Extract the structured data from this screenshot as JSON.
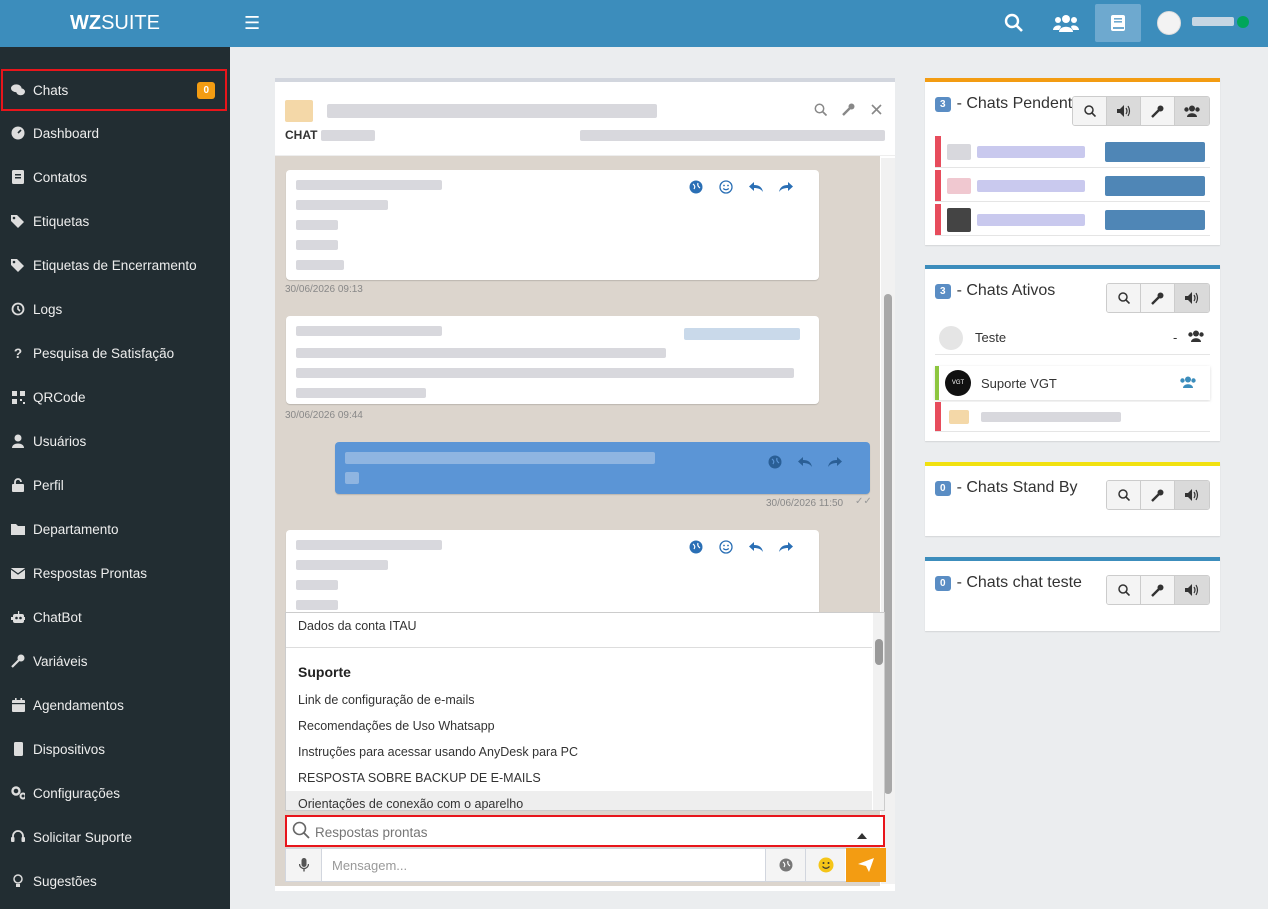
{
  "brand": {
    "bold": "WZ",
    "rest": "SUITE"
  },
  "colors": {
    "primary": "#3c8dbc",
    "sidebar": "#222d32",
    "warning": "#f39c12",
    "danger": "#e8151b",
    "online": "#00a65a"
  },
  "sidebar": {
    "items": [
      {
        "label": "Chats",
        "icon": "chats-icon",
        "badge": "0"
      },
      {
        "label": "Dashboard",
        "icon": "dashboard-icon"
      },
      {
        "label": "Contatos",
        "icon": "contacts-icon"
      },
      {
        "label": "Etiquetas",
        "icon": "tags-icon"
      },
      {
        "label": "Etiquetas de Encerramento",
        "icon": "tags-icon"
      },
      {
        "label": "Logs",
        "icon": "history-icon"
      },
      {
        "label": "Pesquisa de Satisfação",
        "icon": "question-icon"
      },
      {
        "label": "QRCode",
        "icon": "qrcode-icon"
      },
      {
        "label": "Usuários",
        "icon": "user-icon"
      },
      {
        "label": "Perfil",
        "icon": "unlock-icon"
      },
      {
        "label": "Departamento",
        "icon": "folder-icon"
      },
      {
        "label": "Respostas Prontas",
        "icon": "envelope-icon"
      },
      {
        "label": "ChatBot",
        "icon": "robot-icon"
      },
      {
        "label": "Variáveis",
        "icon": "key-icon"
      },
      {
        "label": "Agendamentos",
        "icon": "calendar-icon"
      },
      {
        "label": "Dispositivos",
        "icon": "mobile-icon"
      },
      {
        "label": "Configurações",
        "icon": "cogs-icon"
      },
      {
        "label": "Solicitar Suporte",
        "icon": "headset-icon"
      },
      {
        "label": "Sugestões",
        "icon": "lightbulb-icon"
      }
    ]
  },
  "chat": {
    "label": "CHAT",
    "timestamps": [
      "30/06/2026 09:13",
      "30/06/2026 09:44",
      "30/06/2026 11:50"
    ]
  },
  "dropdown": {
    "items_top": [
      "Dados da conta ITAU"
    ],
    "group": "Suporte",
    "items": [
      "Link de configuração de e-mails",
      "Recomendações de Uso Whatsapp",
      "Instruções para acessar usando AnyDesk para PC",
      "RESPOSTA SOBRE BACKUP DE E-MAILS",
      "Orientações de conexão com o aparelho"
    ]
  },
  "search": {
    "placeholder": "Respostas prontas"
  },
  "composer": {
    "placeholder": "Mensagem..."
  },
  "boxes": {
    "pending": {
      "count": "3",
      "title": "- Chats Pendentes"
    },
    "active": {
      "count": "3",
      "title": "- Chats Ativos",
      "contacts": [
        {
          "name": "Teste",
          "dash": "-"
        },
        {
          "name": "Suporte VGT"
        }
      ]
    },
    "standby": {
      "count": "0",
      "title": "- Chats Stand By"
    },
    "test": {
      "count": "0",
      "title": "- Chats chat teste"
    }
  }
}
